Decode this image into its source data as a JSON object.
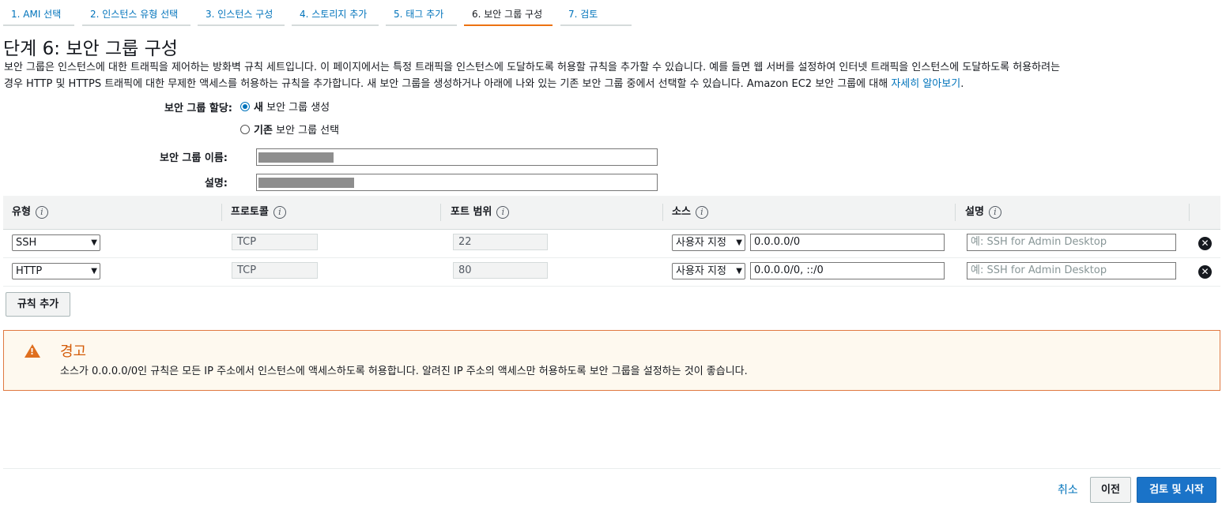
{
  "tabs": [
    "1. AMI 선택",
    "2. 인스턴스 유형 선택",
    "3. 인스턴스 구성",
    "4. 스토리지 추가",
    "5. 태그 추가",
    "6. 보안 그룹 구성",
    "7. 검토"
  ],
  "title": "단계 6: 보안 그룹 구성",
  "description": {
    "line1": "보안 그룹은 인스턴스에 대한 트래픽을 제어하는 방화벽 규칙 세트입니다. 이 페이지에서는 특정 트래픽을 인스턴스에 도달하도록 허용할 규칙을 추가할 수 있습니다. 예를 들면 웹 서버를 설정하여 인터넷 트래픽을 인스턴스에 도달하도록 허용하려는",
    "line2": "경우 HTTP 및 HTTPS 트래픽에 대한 무제한 액세스를 허용하는 규칙을 추가합니다. 새 보안 그룹을 생성하거나 아래에 나와 있는 기존 보안 그룹 중에서 선택할 수 있습니다. Amazon EC2 보안 그룹에 대해 ",
    "link": "자세히 알아보기",
    "end": "."
  },
  "assign": {
    "label": "보안 그룹 할당:",
    "option_new_bold": "새",
    "option_new_rest": "보안 그룹 생성",
    "option_existing_bold": "기존",
    "option_existing_rest": "보안 그룹 선택",
    "selected": "new"
  },
  "fields": {
    "name_label": "보안 그룹 이름:",
    "desc_label": "설명:"
  },
  "table": {
    "headers": [
      "유형",
      "프로토콜",
      "포트 범위",
      "소스",
      "설명"
    ],
    "info_glyph": "i",
    "rows": [
      {
        "type": "SSH",
        "protocol": "TCP",
        "port": "22",
        "source_mode": "사용자 지정",
        "source": "0.0.0.0/0",
        "desc_placeholder": "예: SSH for Admin Desktop"
      },
      {
        "type": "HTTP",
        "protocol": "TCP",
        "port": "80",
        "source_mode": "사용자 지정",
        "source": "0.0.0.0/0, ::/0",
        "desc_placeholder": "예: SSH for Admin Desktop"
      }
    ]
  },
  "add_rule_label": "규칙 추가",
  "warning": {
    "title": "경고",
    "message": "소스가 0.0.0.0/0인 규칙은 모든 IP 주소에서 인스턴스에 액세스하도록 허용합니다. 알려진 IP 주소의 액세스만 허용하도록 보안 그룹을 설정하는 것이 좋습니다."
  },
  "footer": {
    "cancel": "취소",
    "previous": "이전",
    "review_launch": "검토 및 시작"
  },
  "colors": {
    "accent": "#ec7211",
    "link": "#0073bb",
    "primary": "#1a73c8",
    "warning": "#d45b07"
  }
}
